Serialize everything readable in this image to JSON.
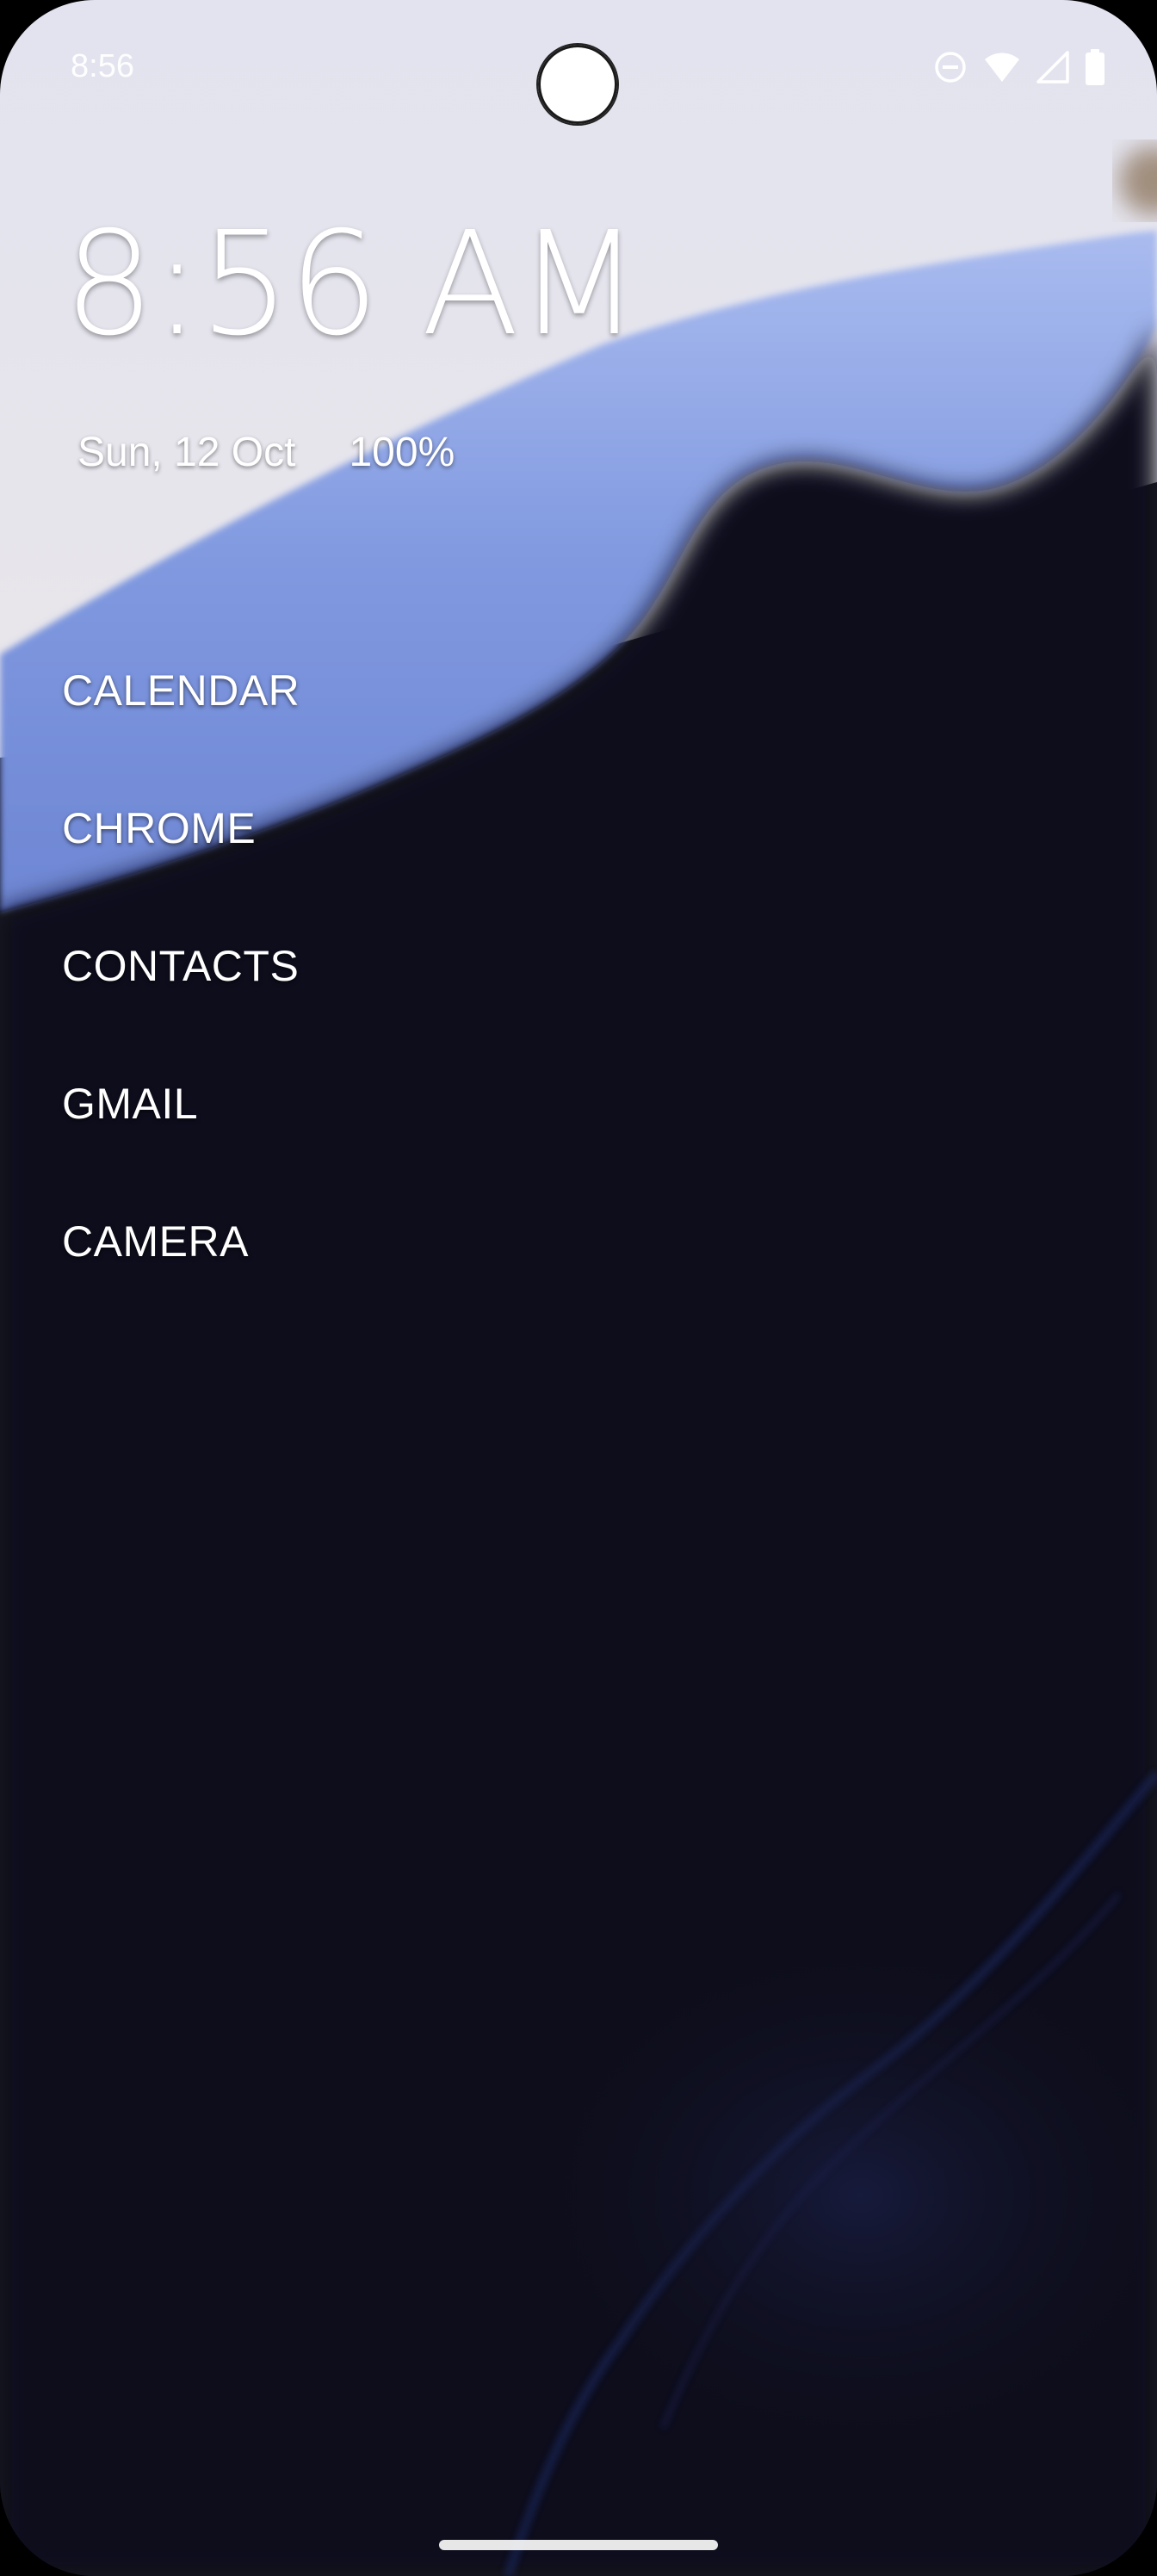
{
  "status_bar": {
    "time": "8:56",
    "icons": [
      "do-not-disturb-icon",
      "wifi-icon",
      "cellular-signal-icon",
      "battery-icon"
    ]
  },
  "clock_widget": {
    "time": "8:56 AM",
    "date": "Sun, 12 Oct",
    "battery": "100%"
  },
  "app_list": {
    "items": [
      {
        "label": "CALENDAR"
      },
      {
        "label": "CHROME"
      },
      {
        "label": "CONTACTS"
      },
      {
        "label": "GMAIL"
      },
      {
        "label": "CAMERA"
      }
    ]
  },
  "colors": {
    "background": "#11111c",
    "wallpaper_light": "#e3e4ef",
    "wallpaper_blue": "#8aa2e3",
    "text": "#ffffff"
  }
}
